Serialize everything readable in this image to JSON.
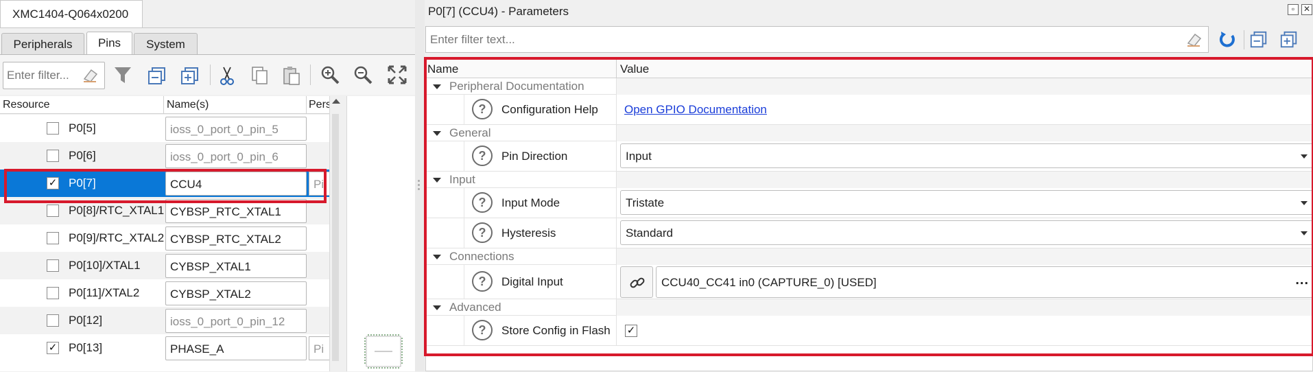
{
  "left": {
    "doc_tab": "XMC1404-Q064x0200",
    "tabs": [
      {
        "label": "Peripherals",
        "active": false
      },
      {
        "label": "Pins",
        "active": true
      },
      {
        "label": "System",
        "active": false
      }
    ],
    "filter_placeholder": "Enter filter...",
    "toolbar_icons": [
      "eraser-icon",
      "funnel-icon",
      "collapse-all-icon",
      "expand-all-icon",
      "cut-icon",
      "copy-icon",
      "paste-icon",
      "zoom-in-icon",
      "zoom-out-icon",
      "fit-view-icon"
    ],
    "columns": [
      "Resource",
      "Name(s)",
      "Pers"
    ],
    "rows": [
      {
        "checked": false,
        "resource": "P0[5]",
        "name": "ioss_0_port_0_pin_5",
        "placeholder": true,
        "pers": ""
      },
      {
        "checked": false,
        "resource": "P0[6]",
        "name": "ioss_0_port_0_pin_6",
        "placeholder": true,
        "pers": ""
      },
      {
        "checked": true,
        "resource": "P0[7]",
        "name": "CCU4",
        "placeholder": false,
        "pers": "Pi",
        "selected": true
      },
      {
        "checked": false,
        "resource": "P0[8]/RTC_XTAL1",
        "name": "CYBSP_RTC_XTAL1",
        "placeholder": false,
        "pers": ""
      },
      {
        "checked": false,
        "resource": "P0[9]/RTC_XTAL2",
        "name": "CYBSP_RTC_XTAL2",
        "placeholder": false,
        "pers": ""
      },
      {
        "checked": false,
        "resource": "P0[10]/XTAL1",
        "name": "CYBSP_XTAL1",
        "placeholder": false,
        "pers": ""
      },
      {
        "checked": false,
        "resource": "P0[11]/XTAL2",
        "name": "CYBSP_XTAL2",
        "placeholder": false,
        "pers": ""
      },
      {
        "checked": false,
        "resource": "P0[12]",
        "name": "ioss_0_port_0_pin_12",
        "placeholder": true,
        "pers": ""
      },
      {
        "checked": true,
        "resource": "P0[13]",
        "name": "PHASE_A",
        "placeholder": false,
        "pers": "Pi"
      }
    ]
  },
  "right": {
    "title": "P0[7] (CCU4) - Parameters",
    "filter_placeholder": "Enter filter text...",
    "window_buttons": [
      "restore-icon",
      "close-icon"
    ],
    "toolbar_icons": [
      "eraser-icon",
      "refresh-icon",
      "collapse-all-icon",
      "expand-all-icon"
    ],
    "columns": [
      "Name",
      "Value"
    ],
    "groups": {
      "peripheral_documentation": "Peripheral Documentation",
      "general": "General",
      "input": "Input",
      "connections": "Connections",
      "advanced": "Advanced"
    },
    "params": {
      "config_help": {
        "label": "Configuration Help",
        "value": "Open GPIO Documentation"
      },
      "pin_direction": {
        "label": "Pin Direction",
        "value": "Input"
      },
      "input_mode": {
        "label": "Input Mode",
        "value": "Tristate"
      },
      "hysteresis": {
        "label": "Hysteresis",
        "value": "Standard"
      },
      "digital_input": {
        "label": "Digital Input",
        "value": "CCU40_CC41 in0 (CAPTURE_0) [USED]",
        "more": "..."
      },
      "store_config": {
        "label": "Store Config in Flash",
        "checked": true
      }
    },
    "help_glyph": "?",
    "check_glyph": "✓"
  },
  "colors": {
    "selection_blue": "#0a78d7",
    "highlight_red": "#d7192c",
    "link_blue": "#1a3dd9"
  }
}
